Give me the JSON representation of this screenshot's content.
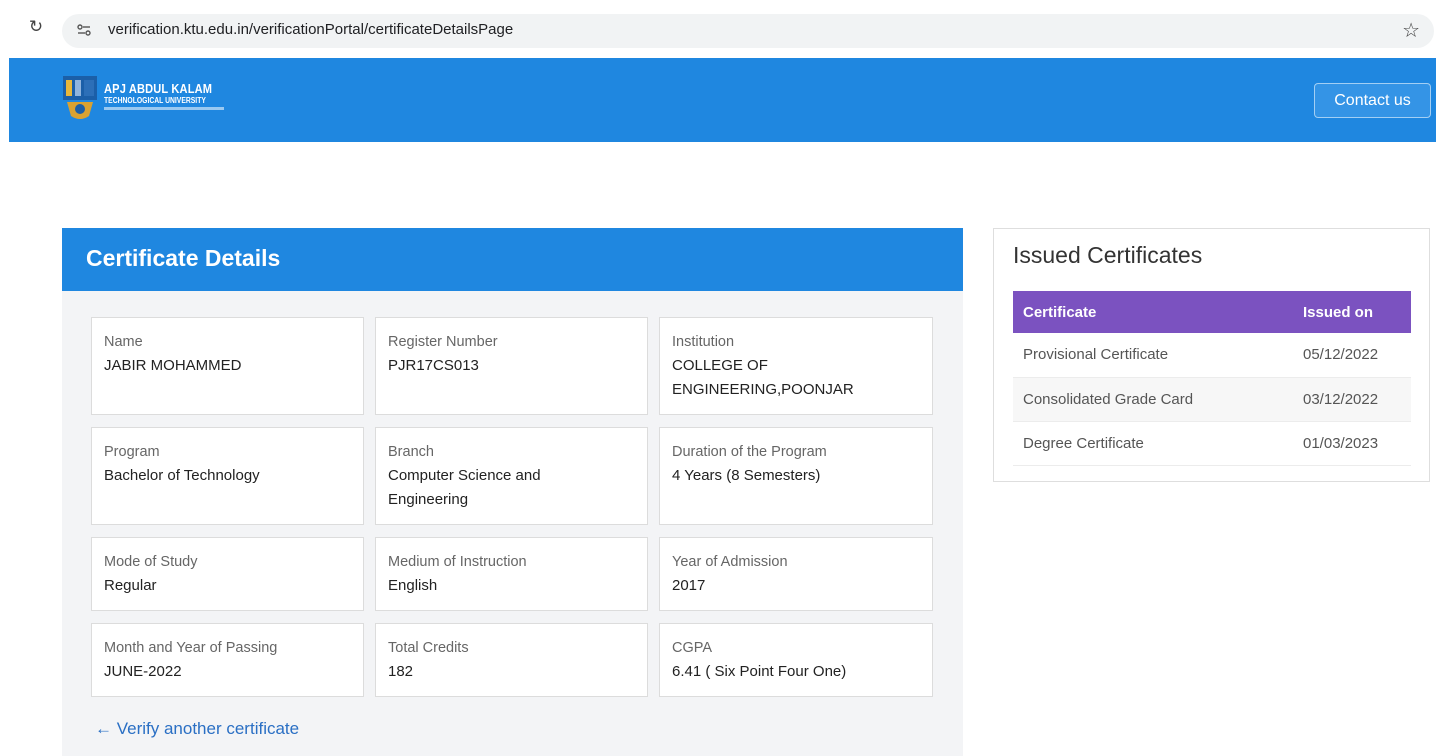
{
  "browser": {
    "url": "verification.ktu.edu.in/verificationPortal/certificateDetailsPage"
  },
  "header": {
    "logo_title": "APJ ABDUL KALAM",
    "logo_subtitle": "TECHNOLOGICAL UNIVERSITY",
    "contact_label": "Contact us"
  },
  "certificate": {
    "title": "Certificate Details",
    "fields": [
      {
        "label": "Name",
        "value": "JABIR MOHAMMED"
      },
      {
        "label": "Register Number",
        "value": "PJR17CS013"
      },
      {
        "label": "Institution",
        "value": "COLLEGE OF ENGINEERING,POONJAR"
      },
      {
        "label": "Program",
        "value": "Bachelor of Technology"
      },
      {
        "label": "Branch",
        "value": "Computer Science and Engineering"
      },
      {
        "label": "Duration of the Program",
        "value": "4 Years (8 Semesters)"
      },
      {
        "label": "Mode of Study",
        "value": "Regular"
      },
      {
        "label": "Medium of Instruction",
        "value": "English"
      },
      {
        "label": "Year of Admission",
        "value": "2017"
      },
      {
        "label": "Month and Year of Passing",
        "value": "JUNE-2022"
      },
      {
        "label": "Total Credits",
        "value": "182"
      },
      {
        "label": "CGPA",
        "value": "6.41 ( Six Point Four One)"
      }
    ],
    "verify_link": "Verify another certificate"
  },
  "issued": {
    "title": "Issued Certificates",
    "columns": [
      "Certificate",
      "Issued on"
    ],
    "rows": [
      {
        "certificate": "Provisional Certificate",
        "issued_on": "05/12/2022"
      },
      {
        "certificate": "Consolidated Grade Card",
        "issued_on": "03/12/2022"
      },
      {
        "certificate": "Degree Certificate",
        "issued_on": "01/03/2023"
      }
    ]
  },
  "colors": {
    "primary_blue": "#1f87e0",
    "table_header_purple": "#7b52c0",
    "link_blue": "#2a6fc4"
  }
}
